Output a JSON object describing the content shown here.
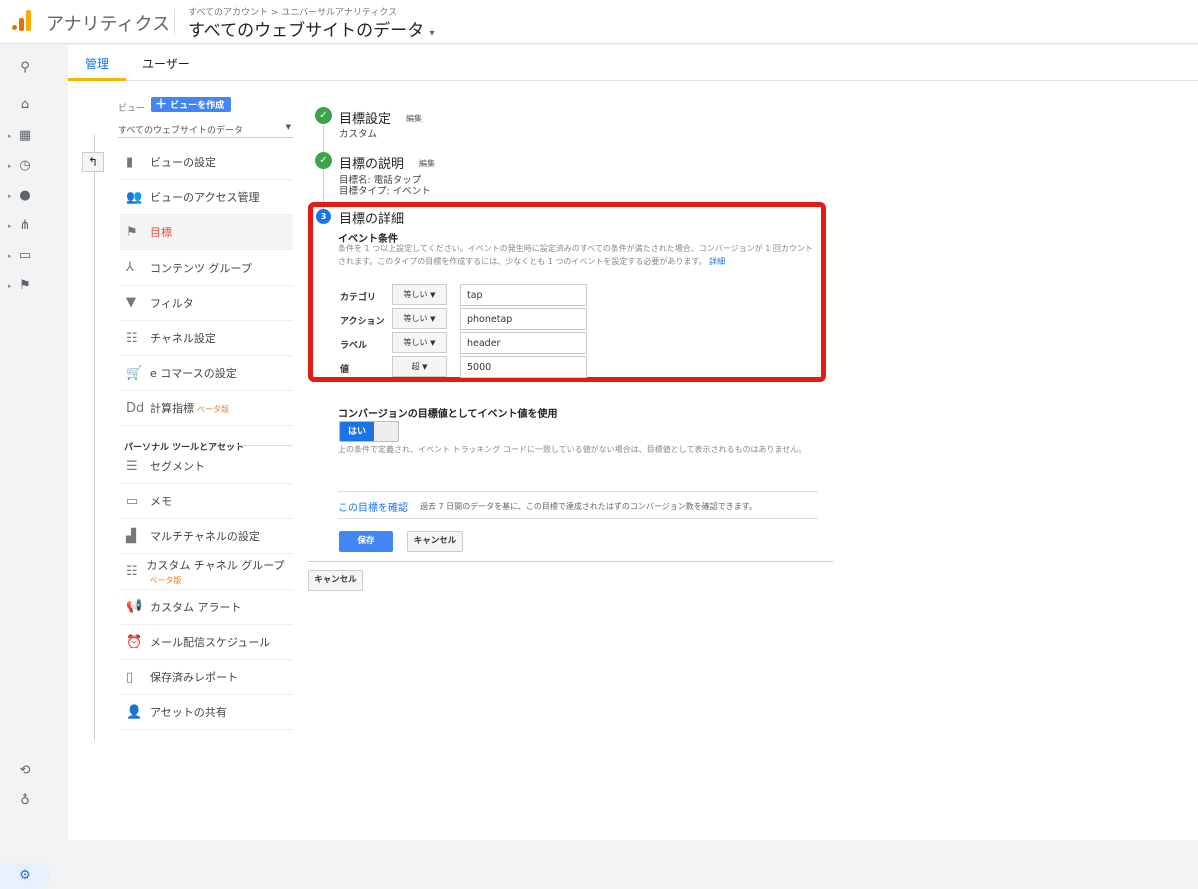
{
  "header": {
    "app_name": "アナリティクス",
    "breadcrumb": "すべてのアカウント > ユニバーサルアナリティクス",
    "property": "すべてのウェブサイトのデータ",
    "brand_color": "#f9ab00"
  },
  "tabs": [
    {
      "label": "管理",
      "active": true
    },
    {
      "label": "ユーザー",
      "active": false
    }
  ],
  "view": {
    "label": "ビュー",
    "create_button": "ビューを作成",
    "selected": "すべてのウェブサイトのデータ"
  },
  "menu": [
    {
      "label": "ビューの設定",
      "icon": "file-icon"
    },
    {
      "label": "ビューのアクセス管理",
      "icon": "people-icon"
    },
    {
      "label": "目標",
      "icon": "flag-icon",
      "active": true
    },
    {
      "label": "コンテンツ グループ",
      "icon": "content-group-icon"
    },
    {
      "label": "フィルタ",
      "icon": "filter-icon"
    },
    {
      "label": "チャネル設定",
      "icon": "channel-icon"
    },
    {
      "label": "e コマースの設定",
      "icon": "cart-icon"
    },
    {
      "label": "計算指標",
      "icon": "dd-icon",
      "badge": "ベータ版"
    }
  ],
  "personal_section": "パーソナル ツールとアセット",
  "personal_menu": [
    {
      "label": "セグメント",
      "icon": "segment-icon"
    },
    {
      "label": "メモ",
      "icon": "memo-icon"
    },
    {
      "label": "マルチチャネルの設定",
      "icon": "bar-chart-icon"
    },
    {
      "label": "カスタム チャネル グループ",
      "icon": "channel-icon",
      "badge": "ベータ版"
    },
    {
      "label": "カスタム アラート",
      "icon": "megaphone-icon"
    },
    {
      "label": "メール配信スケジュール",
      "icon": "alarm-icon"
    },
    {
      "label": "保存済みレポート",
      "icon": "report-icon"
    },
    {
      "label": "アセットの共有",
      "icon": "share-user-icon"
    }
  ],
  "steps": {
    "s1": {
      "title": "目標設定",
      "edit": "編集",
      "sub": "カスタム"
    },
    "s2": {
      "title": "目標の説明",
      "edit": "編集",
      "sub1": "目標名: 電話タップ",
      "sub2": "目標タイプ: イベント"
    },
    "s3": {
      "number": "3",
      "title": "目標の詳細"
    }
  },
  "event": {
    "title": "イベント条件",
    "desc": "条件を 1 つ以上設定してください。イベントの発生時に設定済みのすべての条件が満たされた場合、コンバージョンが 1 回カウントされます。このタイプの目標を作成するには、少なくとも 1 つのイベントを設定する必要があります。",
    "details_link": "詳細",
    "rows": [
      {
        "label": "カテゴリ",
        "op": "等しい",
        "value": "tap"
      },
      {
        "label": "アクション",
        "op": "等しい",
        "value": "phonetap"
      },
      {
        "label": "ラベル",
        "op": "等しい",
        "value": "header"
      },
      {
        "label": "値",
        "op": "超",
        "value": "5000"
      }
    ]
  },
  "conversion": {
    "title": "コンバージョンの目標値としてイベント値を使用",
    "toggle_label": "はい",
    "toggle_on": true,
    "desc": "上の条件で定義され、イベント トラッキング コードに一致している値がない場合は、目標値として表示されるものはありません。"
  },
  "verify": {
    "link": "この目標を確認",
    "desc": "過去 7 日間のデータを基に、この目標で達成されたはずのコンバージョン数を確認できます。"
  },
  "buttons": {
    "save": "保存",
    "cancel": "キャンセル",
    "cancel_outer": "キャンセル"
  },
  "highlight_color": "#e31b13"
}
